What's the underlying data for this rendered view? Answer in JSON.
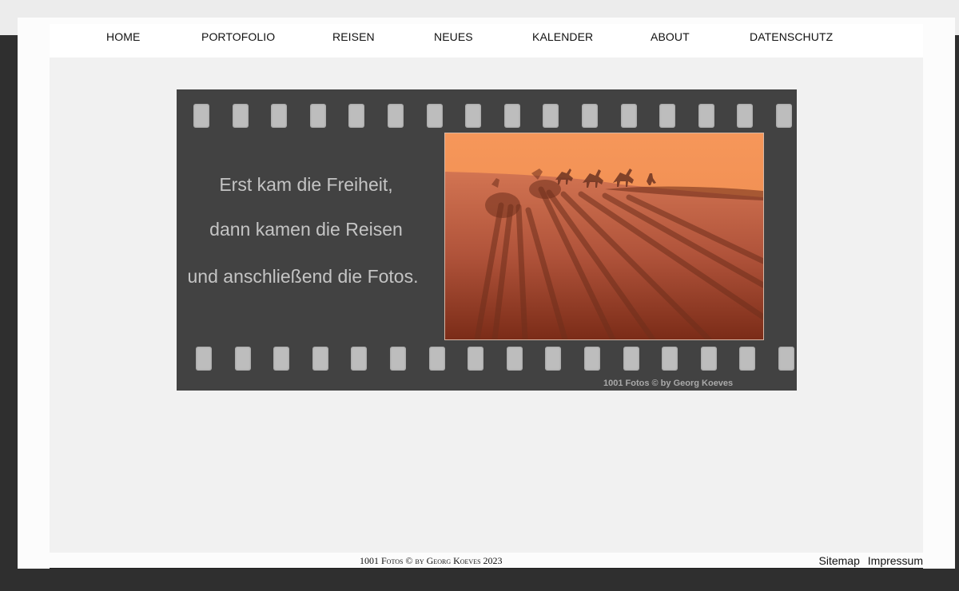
{
  "nav": {
    "home": "HOME",
    "portfolio": "PORTOFOLIO",
    "reisen": "REISEN",
    "neues": "NEUES",
    "kalender": "KALENDER",
    "about": "ABOUT",
    "datenschutz": "DATENSCHUTZ"
  },
  "banner": {
    "line1": "Erst kam die Freiheit,",
    "line2": "dann kamen die Reisen",
    "line3": "und anschließend die Fotos.",
    "credit": "1001 Fotos © by Georg Koeves"
  },
  "footer": {
    "copyright": "1001 Fotos © by Georg Koeves 2023",
    "sitemap": "Sitemap",
    "impressum": "Impressum"
  },
  "colors": {
    "film": "#424242",
    "sprocket": "#bdbdbd",
    "sky": "#f08a4a",
    "sand": "#a9492a"
  }
}
